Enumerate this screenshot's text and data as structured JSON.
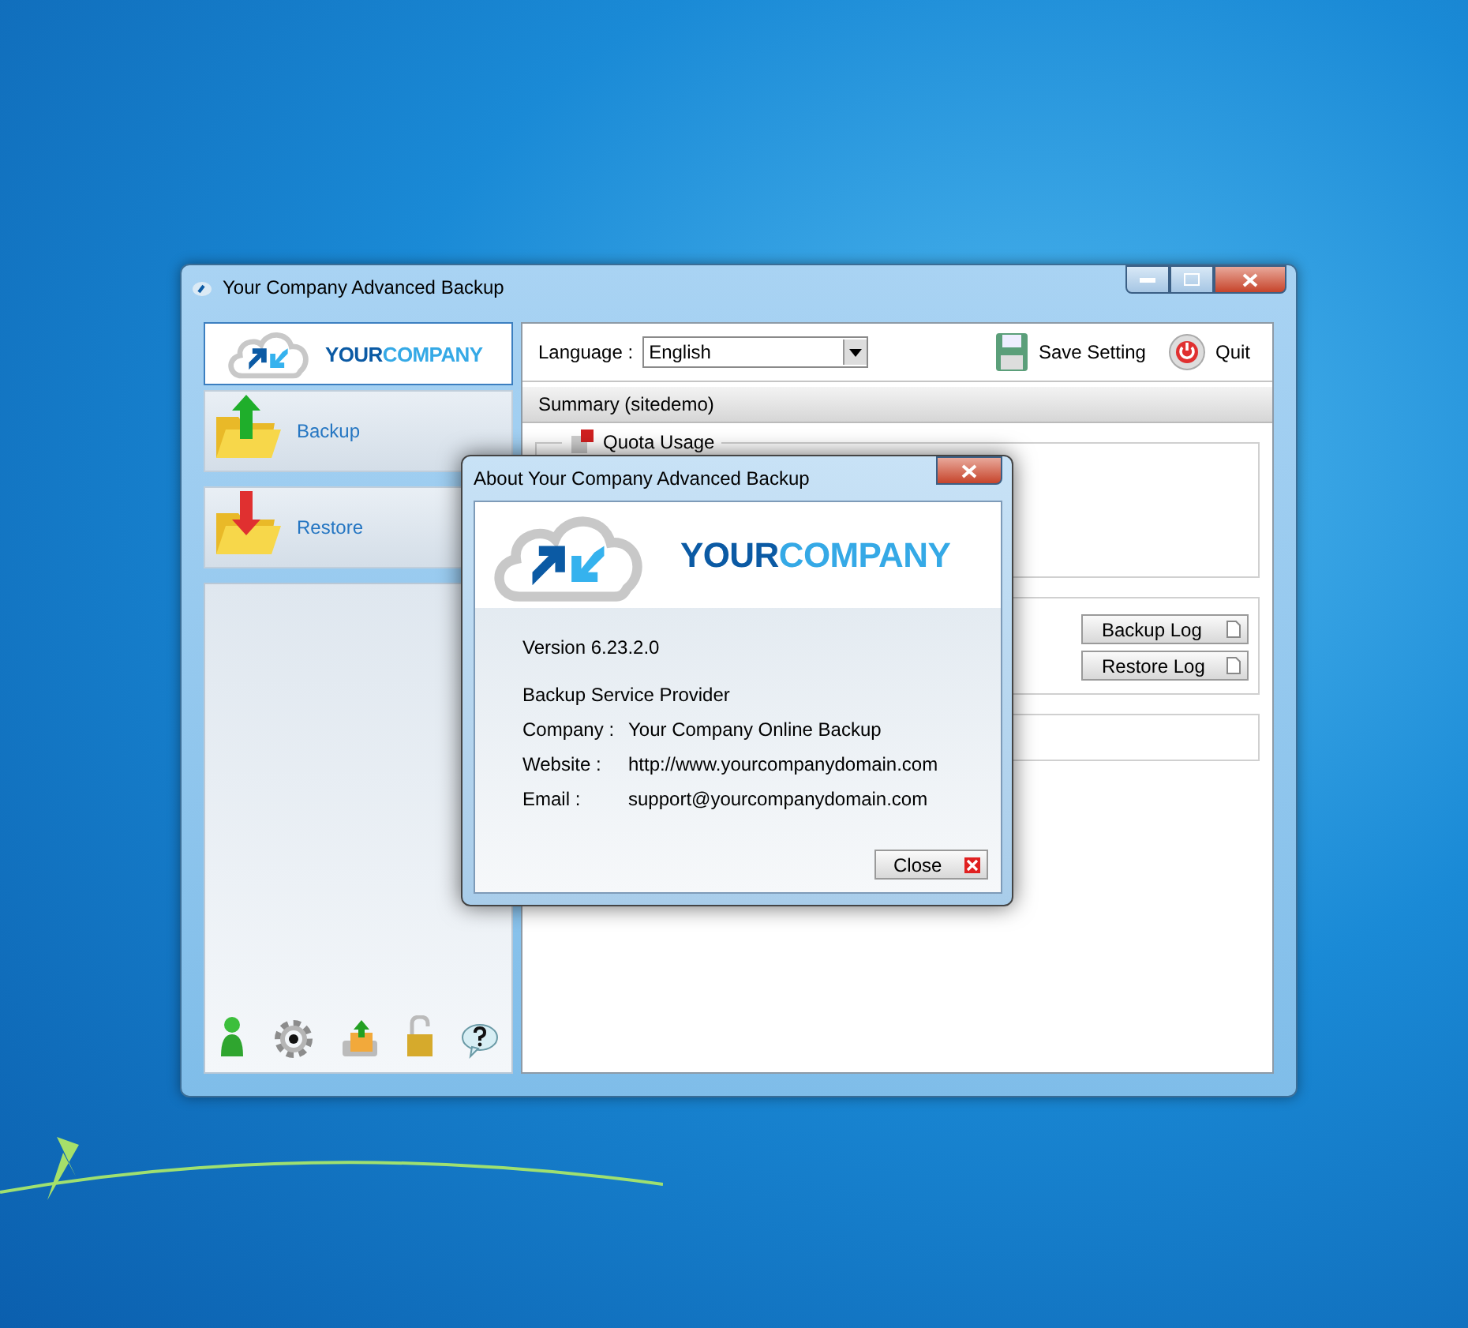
{
  "main_window": {
    "title": "Your Company Advanced Backup",
    "logo": {
      "brand_part_1": "YOUR",
      "brand_part_2": "COMPANY"
    },
    "nav": [
      {
        "label": "Backup",
        "kind": "backup"
      },
      {
        "label": "Restore",
        "kind": "restore"
      }
    ],
    "toolbar": {
      "language_label": "Language :",
      "language_value": "English",
      "save_setting": "Save Setting",
      "quit": "Quit"
    },
    "summary_header": "Summary (sitedemo)",
    "quota_group": "Quota Usage",
    "log_buttons": [
      "Backup Log",
      "Restore Log"
    ]
  },
  "about_dialog": {
    "title": "About Your Company Advanced Backup",
    "logo": {
      "brand_part_1": "YOUR",
      "brand_part_2": "COMPANY"
    },
    "version": "Version 6.23.2.0",
    "provider_heading": "Backup Service Provider",
    "details": [
      {
        "label": "Company :",
        "value": "Your Company Online Backup"
      },
      {
        "label": "Website :",
        "value": "http://www.yourcompanydomain.com"
      },
      {
        "label": "Email :",
        "value": "support@yourcompanydomain.com"
      }
    ],
    "close_button": "Close"
  }
}
